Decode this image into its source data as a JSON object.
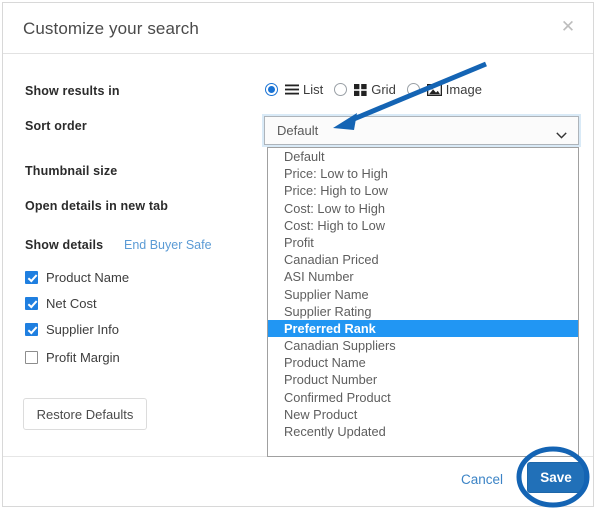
{
  "dialog": {
    "title": "Customize your search",
    "close_icon": "close-icon"
  },
  "fields": {
    "show_results_label": "Show results in",
    "sort_order_label": "Sort order",
    "thumbnail_size_label": "Thumbnail size",
    "open_details_label": "Open details in new tab",
    "show_details_label": "Show details",
    "end_buyer_safe_link": "End Buyer Safe"
  },
  "view_options": [
    {
      "label": "List",
      "icon": "list-icon",
      "selected": true
    },
    {
      "label": "Grid",
      "icon": "grid-icon",
      "selected": false
    },
    {
      "label": "Image",
      "icon": "image-icon",
      "selected": false
    }
  ],
  "sort_order": {
    "selected_value": "Default",
    "caret_icon": "chevron-down-icon",
    "highlighted_option": "Preferred Rank",
    "options": [
      "Default",
      "Price: Low to High",
      "Price: High to Low",
      "Cost: Low to High",
      "Cost: High to Low",
      "Profit",
      "Canadian Priced",
      "ASI Number",
      "Supplier Name",
      "Supplier Rating",
      "Preferred Rank",
      "Canadian Suppliers",
      "Product Name",
      "Product Number",
      "Confirmed Product",
      "New Product",
      "Recently Updated"
    ]
  },
  "show_details_checkboxes": [
    {
      "label": "Product Name",
      "checked": true
    },
    {
      "label": "Net Cost",
      "checked": true
    },
    {
      "label": "Supplier Info",
      "checked": true
    },
    {
      "label": "Profit Margin",
      "checked": false
    }
  ],
  "buttons": {
    "restore_defaults": "Restore Defaults",
    "cancel": "Cancel",
    "save": "Save"
  },
  "colors": {
    "accent_blue": "#2170b8",
    "highlight_blue": "#2196f3",
    "link_blue": "#3c84c6",
    "annotation_blue": "#1464b4",
    "checkbox_blue": "#1f7fe0"
  },
  "annotations": {
    "arrow": "blue-arrow-pointing-to-sort-order-dropdown",
    "ellipse": "blue-ellipse-around-save-button"
  }
}
